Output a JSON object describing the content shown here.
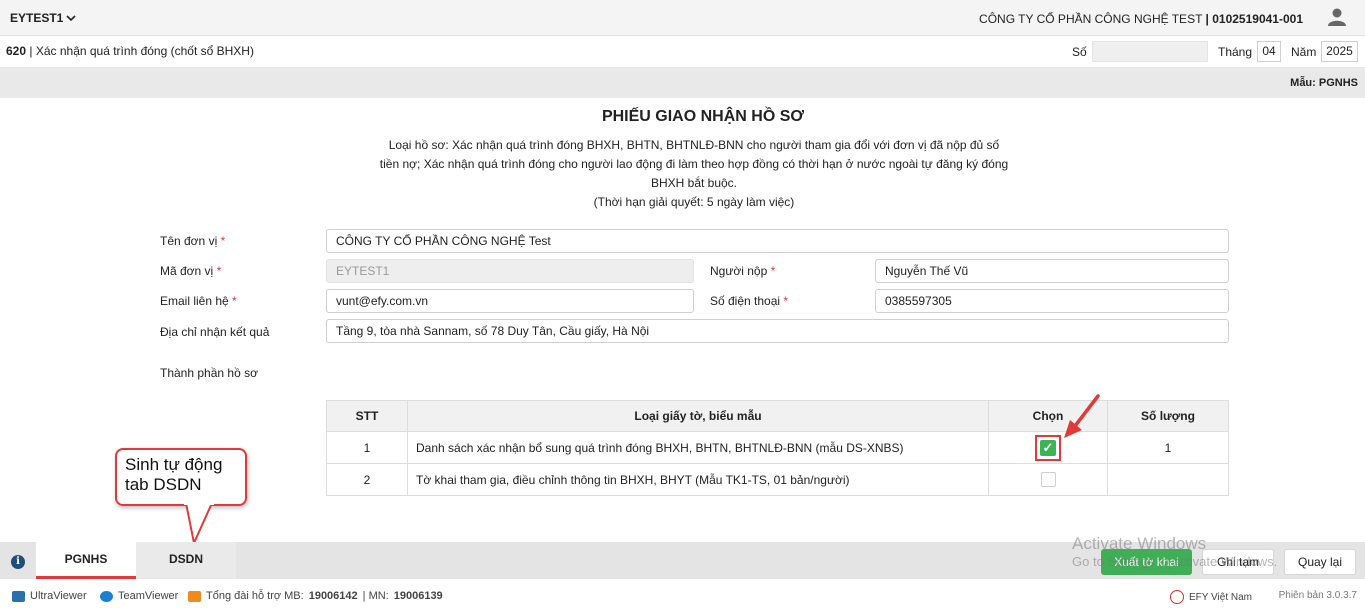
{
  "header": {
    "app_name": "EYTEST1",
    "company": "CÔNG TY CỔ PHẦN CÔNG NGHỆ TEST",
    "tax_code": "0102519041-001"
  },
  "form_bar": {
    "code": "620",
    "name": "Xác nhận quá trình đóng (chốt sổ BHXH)",
    "so_label": "Số",
    "so_value": "",
    "thang_label": "Tháng",
    "thang_value": "04",
    "nam_label": "Năm",
    "nam_value": "2025"
  },
  "mau": "Mẫu: PGNHS",
  "doc": {
    "title": "PHIẾU GIAO NHẬN HỒ SƠ",
    "desc_lines": [
      "Loại hồ sơ: Xác nhận quá trình đóng BHXH, BHTN, BHTNLĐ-BNN cho người tham gia đổi với đơn vị đã nộp đủ số",
      "tiền nợ; Xác nhận quá trình đóng cho người lao động đi làm theo hợp đồng có thời hạn ở nước ngoài tự đăng ký đóng",
      "BHXH bắt buộc.",
      "(Thời hạn giải quyết: 5 ngày làm việc)"
    ]
  },
  "fields": {
    "ten_don_vi": {
      "label": "Tên đơn vị",
      "value": "CÔNG TY CỔ PHẦN CÔNG NGHỆ Test"
    },
    "ma_don_vi": {
      "label": "Mã đơn vị",
      "value": "EYTEST1"
    },
    "nguoi_nop": {
      "label": "Người nộp",
      "value": "Nguyễn Thế Vũ"
    },
    "email": {
      "label": "Email liên hệ",
      "value": "vunt@efy.com.vn"
    },
    "so_dien_thoai": {
      "label": "Số điện thoại",
      "value": "0385597305"
    },
    "dia_chi": {
      "label": "Địa chỉ nhận kết quả",
      "value": "Tầng 9, tòa nhà Sannam, số 78 Duy Tân, Cầu giấy, Hà Nội"
    },
    "thanh_phan_label": "Thành phần hồ sơ",
    "required_mark": "*"
  },
  "table": {
    "headers": [
      "STT",
      "Loại giấy tờ, biểu mẫu",
      "Chọn",
      "Số lượng"
    ],
    "rows": [
      {
        "stt": "1",
        "name": "Danh sách xác nhận bổ sung quá trình đóng BHXH, BHTN, BHTNLĐ-BNN (mẫu DS-XNBS)",
        "checked": true,
        "qty": "1"
      },
      {
        "stt": "2",
        "name": "Tờ khai tham gia, điều chỉnh thông tin BHXH, BHYT (Mẫu TK1-TS, 01 bản/người)",
        "checked": false,
        "qty": ""
      }
    ]
  },
  "callout": {
    "line1": "Sinh tự động",
    "line2": "tab DSDN"
  },
  "tabs": [
    {
      "label": "PGNHS",
      "active": true
    },
    {
      "label": "DSDN",
      "active": false
    }
  ],
  "buttons": {
    "export": "Xuất tờ khai",
    "save_draft": "Ghi tạm",
    "back": "Quay lại"
  },
  "watermark": {
    "line1": "Activate Windows",
    "line2": "Go to Settings to activate Windows."
  },
  "statusbar": {
    "ultraviewer": "UltraViewer",
    "teamviewer": "TeamViewer",
    "hotline_prefix": "Tổng đài hỗ trợ MB:",
    "hotline_mb": "19006142",
    "hotline_mn_prefix": "| MN:",
    "hotline_mn": "19006139",
    "brand": "EFY Việt Nam",
    "version": "Phiên bản 3.0.3.7"
  },
  "colors": {
    "accent_red": "#e23a3a",
    "primary_green": "#3fae56",
    "checkbox_green": "#3bb454"
  }
}
